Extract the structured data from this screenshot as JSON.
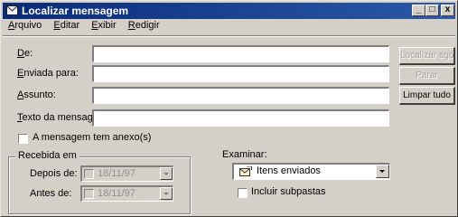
{
  "window": {
    "title": "Localizar mensagem",
    "controls": [
      "_",
      "□",
      "x"
    ]
  },
  "menu": [
    "Arquivo",
    "Editar",
    "Exibir",
    "Redigir"
  ],
  "fields": [
    {
      "label": "De:",
      "value": ""
    },
    {
      "label": "Enviada para:",
      "value": ""
    },
    {
      "label": "Assunto:",
      "value": ""
    },
    {
      "label": "Texto da mensagem:",
      "value": ""
    }
  ],
  "buttons": {
    "find_now": "Localizar agora",
    "stop": "Parar",
    "clear_all": "Limpar tudo"
  },
  "attachment_checkbox": {
    "label": "A mensagem tem anexo(s)",
    "checked": false
  },
  "received_group": {
    "title": "Recebida em",
    "after": {
      "label": "Depois de:",
      "date": "18/11/97",
      "enabled": false
    },
    "before": {
      "label": "Antes de:",
      "date": "18/11/97",
      "enabled": false
    }
  },
  "examine": {
    "label": "Examinar:",
    "selected_folder": "Itens enviados",
    "folder_icon": "sent-items-icon",
    "include_subfolders": {
      "label": "Incluir subpastas",
      "checked": false
    }
  }
}
